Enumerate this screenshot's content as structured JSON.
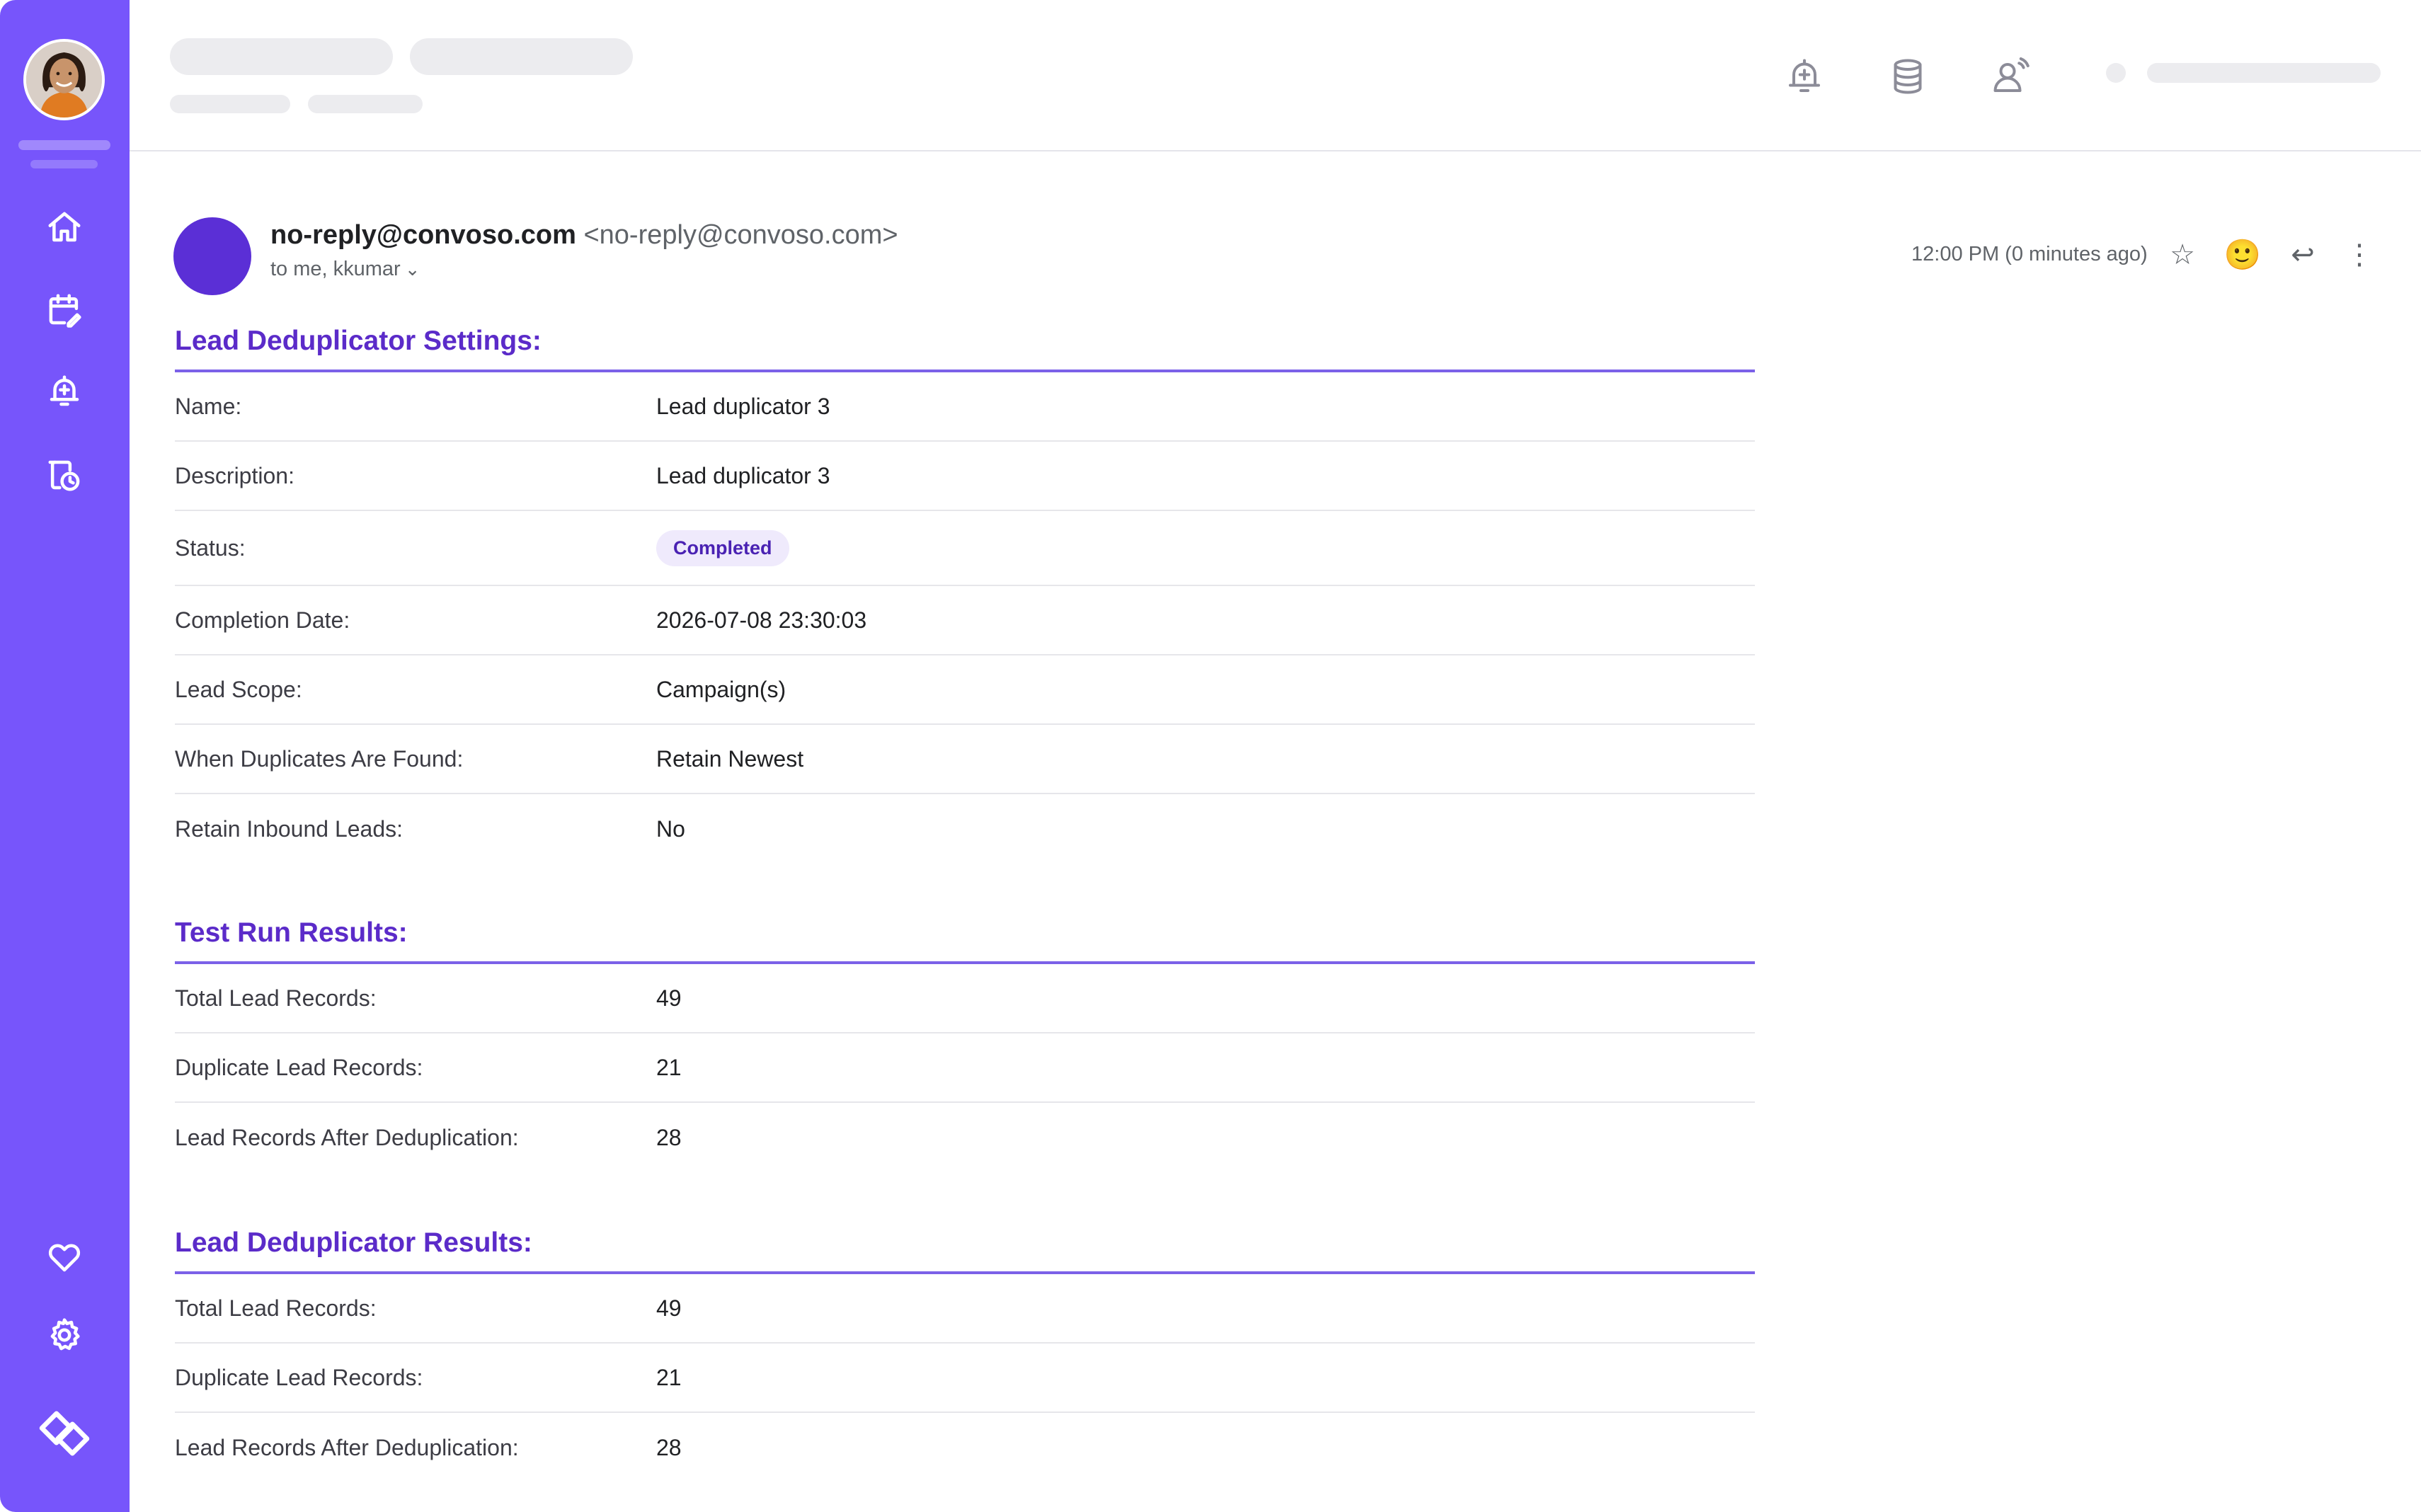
{
  "colors": {
    "sidebar": "#7755fb",
    "accent": "#5b2bc9",
    "divider": "#7b61e8",
    "badge_bg": "#efeafc",
    "sender_avatar": "#5b2fd6"
  },
  "sidebar": {
    "icons": [
      "home-icon",
      "calendar-edit-icon",
      "alarm-add-icon",
      "history-icon",
      "heart-icon",
      "gear-icon",
      "brand-logo-icon"
    ]
  },
  "topbar": {
    "icons": [
      "bell-add-icon",
      "database-icon",
      "user-signal-icon"
    ]
  },
  "email": {
    "sender_name": "no-reply@convoso.com",
    "sender_email": "<no-reply@convoso.com>",
    "recipients": "to me, kkumar",
    "recipients_chevron": "⌄",
    "timestamp": "12:00 PM (0 minutes ago)",
    "actions": {
      "star": "☆",
      "emoji": "🙂",
      "reply": "↩",
      "more": "⋮"
    }
  },
  "settings": {
    "title": "Lead Deduplicator Settings:",
    "rows": [
      {
        "label": "Name:",
        "value": "Lead duplicator 3"
      },
      {
        "label": "Description:",
        "value": "Lead duplicator 3"
      },
      {
        "label": "Status:",
        "value": "Completed"
      },
      {
        "label": "Completion Date:",
        "value": "2026-07-08 23:30:03"
      },
      {
        "label": "Lead Scope:",
        "value": "Campaign(s)"
      },
      {
        "label": "When Duplicates Are Found:",
        "value": "Retain Newest"
      },
      {
        "label": "Retain Inbound Leads:",
        "value": "No"
      }
    ]
  },
  "test_run": {
    "title": "Test Run Results:",
    "rows": [
      {
        "label": "Total Lead Records:",
        "value": "49"
      },
      {
        "label": "Duplicate Lead Records:",
        "value": "21"
      },
      {
        "label": "Lead Records After Deduplication:",
        "value": "28"
      }
    ]
  },
  "results": {
    "title": "Lead Deduplicator Results:",
    "rows": [
      {
        "label": "Total Lead Records:",
        "value": "49"
      },
      {
        "label": "Duplicate Lead Records:",
        "value": "21"
      },
      {
        "label": "Lead Records After Deduplication:",
        "value": "28"
      }
    ]
  }
}
